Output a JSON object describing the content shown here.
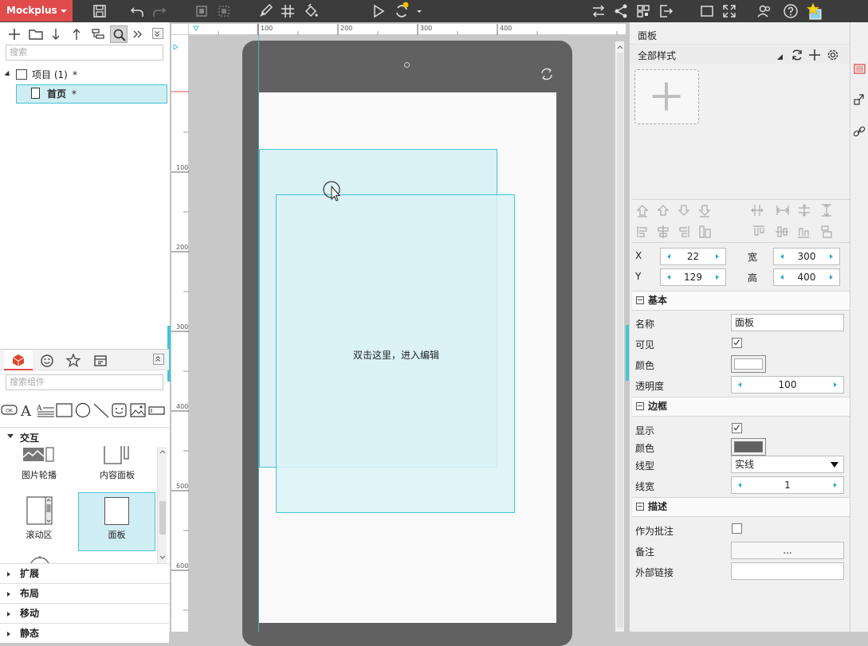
{
  "app": {
    "name": "Mockplus"
  },
  "left": {
    "search_placeholder": "搜索",
    "tree": [
      {
        "label": "项目 (1)",
        "suffix": "*"
      },
      {
        "label": "首页",
        "suffix": "*"
      }
    ],
    "component_search_placeholder": "搜索组件",
    "category_open": "交互",
    "components": [
      {
        "label": "图片轮播"
      },
      {
        "label": "内容面板"
      },
      {
        "label": "滚动区"
      },
      {
        "label": "面板"
      }
    ],
    "categories": [
      "扩展",
      "布局",
      "移动",
      "静态"
    ]
  },
  "canvas": {
    "ruler_top": [
      "100",
      "200",
      "300",
      "400"
    ],
    "ruler_left": [
      "100",
      "200",
      "300",
      "400",
      "500",
      "600"
    ],
    "panel_text": "双击这里，进入编辑"
  },
  "right": {
    "title": "面板",
    "style_label": "全部样式",
    "pos": {
      "x_label": "X",
      "x": "22",
      "y_label": "Y",
      "y": "129",
      "w_label": "宽",
      "w": "300",
      "h_label": "高",
      "h": "400"
    },
    "basic": {
      "title": "基本",
      "name_label": "名称",
      "name_value": "面板",
      "visible_label": "可见",
      "visible": true,
      "color_label": "颜色",
      "color": "#ffffff",
      "opacity_label": "透明度",
      "opacity": "100"
    },
    "border": {
      "title": "边框",
      "show_label": "显示",
      "show": true,
      "color_label": "颜色",
      "color": "#616161",
      "linetype_label": "线型",
      "linetype": "实线",
      "width_label": "线宽",
      "width": "1"
    },
    "desc": {
      "title": "描述",
      "as_note_label": "作为批注",
      "as_note": false,
      "note_label": "备注",
      "note_value": "...",
      "link_label": "外部链接",
      "link_value": ""
    }
  },
  "colors": {
    "brand": "#e04b4b",
    "accent": "#45c4d6",
    "selection_fill": "#dbf3f7"
  }
}
